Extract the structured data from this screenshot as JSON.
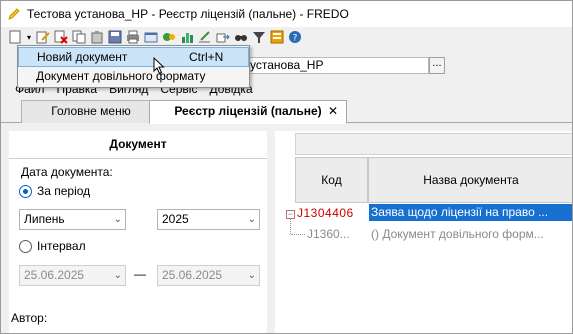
{
  "window": {
    "title": "Тестова установа_НР - Реєстр ліцензій (пальне) - FREDO"
  },
  "toolbar": {
    "buttons": [
      "new-document-icon",
      "edit-icon",
      "delete-icon",
      "copy-icon",
      "paste-icon",
      "save-icon",
      "print-icon",
      "refresh-icon",
      "export-icon",
      "chart-icon",
      "sign-icon",
      "move-icon",
      "find-icon",
      "filter-icon",
      "report-icon",
      "help-icon"
    ]
  },
  "path": {
    "value": "установа_НР",
    "browse_label": "..."
  },
  "menubar": {
    "items": [
      "Файл",
      "Правка",
      "Вигляд",
      "Сервіс",
      "Довідка"
    ]
  },
  "tabs": {
    "main": "Головне меню",
    "active": "Реєстр ліцензій (пальне)",
    "close": "✕"
  },
  "dropdown": {
    "items": [
      {
        "label": "Новий документ",
        "shortcut": "Ctrl+N"
      },
      {
        "label": "Документ довільного формату",
        "shortcut": ""
      }
    ]
  },
  "left_panel": {
    "header": "Документ",
    "date_label": "Дата документа:",
    "period_label": "За період",
    "month": "Липень",
    "year": "2025",
    "interval_label": "Інтервал",
    "date_from": "25.06.2025",
    "date_to": "25.06.2025",
    "dash": "—",
    "author_label": "Автор:"
  },
  "grid": {
    "columns": [
      "Код",
      "Назва документа"
    ],
    "rows": [
      {
        "code": "J1304406",
        "name": "Заява щодо ліцензії на право ..."
      },
      {
        "code": "J1360...",
        "name": "() Документ довільного форм..."
      }
    ],
    "expander": "−"
  },
  "colors": {
    "accent": "#1670d0",
    "error_code": "#cc0000",
    "highlight": "#cce4f7"
  }
}
